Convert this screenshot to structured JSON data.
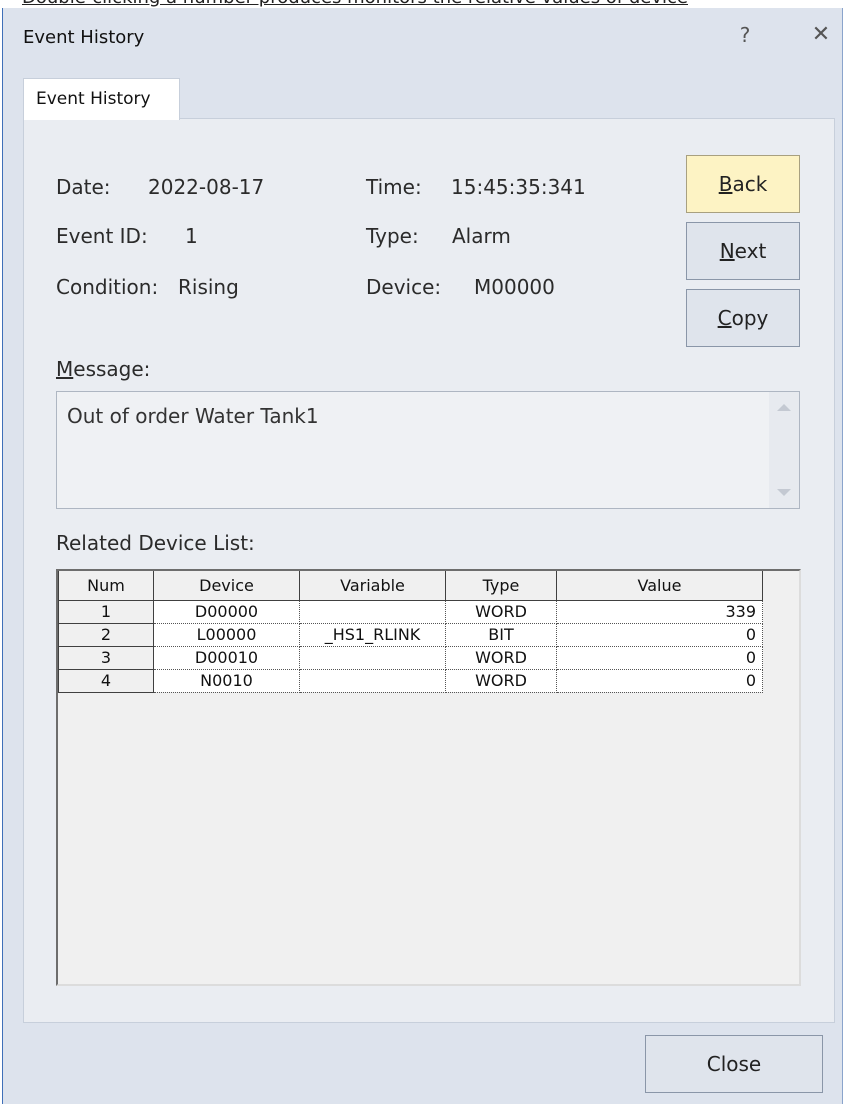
{
  "banner_text": "Double-clicking a number produces monitors the relative values of device",
  "window": {
    "title": "Event History",
    "help_glyph": "?",
    "close_glyph": "✕"
  },
  "tab": {
    "label": "Event History"
  },
  "fields": {
    "date_label": "Date:",
    "date_value": "2022-08-17",
    "time_label": "Time:",
    "time_value": "15:45:35:341",
    "event_id_label": "Event ID:",
    "event_id_value": "1",
    "type_label": "Type:",
    "type_value": "Alarm",
    "condition_label": "Condition:",
    "condition_value": "Rising",
    "device_label": "Device:",
    "device_value": "M00000"
  },
  "buttons": {
    "back": {
      "accel": "B",
      "rest": "ack"
    },
    "next": {
      "accel": "N",
      "rest": "ext"
    },
    "copy": {
      "accel": "C",
      "rest": "opy"
    },
    "close": "Close"
  },
  "message": {
    "label_accel": "M",
    "label_rest": "essage:",
    "text": "Out of order Water Tank1"
  },
  "related": {
    "label": "Related Device List:",
    "columns": [
      "Num",
      "Device",
      "Variable",
      "Type",
      "Value"
    ],
    "rows": [
      {
        "num": "1",
        "device": "D00000",
        "variable": "",
        "type": "WORD",
        "value": "339"
      },
      {
        "num": "2",
        "device": "L00000",
        "variable": "_HS1_RLINK",
        "type": "BIT",
        "value": "0"
      },
      {
        "num": "3",
        "device": "D00010",
        "variable": "",
        "type": "WORD",
        "value": "0"
      },
      {
        "num": "4",
        "device": "N0010",
        "variable": "",
        "type": "WORD",
        "value": "0"
      }
    ]
  },
  "colors": {
    "primary_button": "#fdf3c4",
    "window_bg": "#dde3ed",
    "panel_bg": "#eaedf2"
  }
}
